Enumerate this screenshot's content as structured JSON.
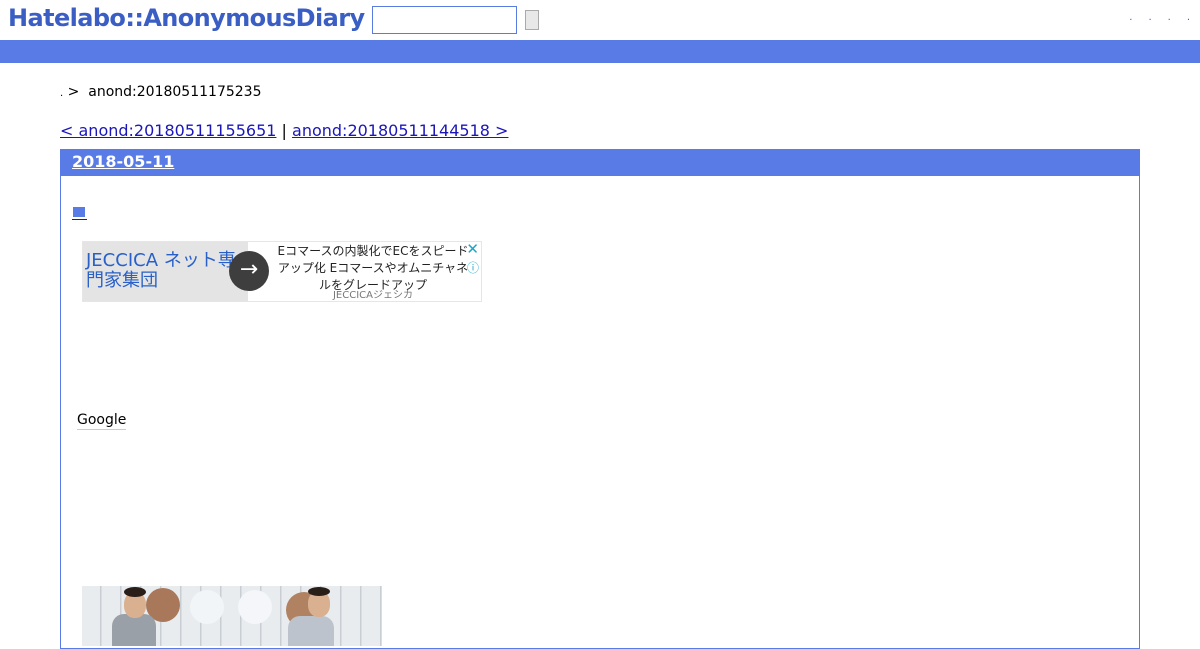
{
  "header": {
    "logo": "Hatelabo::AnonymousDiary",
    "search_value": "",
    "links": [
      ".",
      ".",
      ".",
      "."
    ]
  },
  "breadcrumb": {
    "home": ".",
    "separator": ">",
    "current": "anond:20180511175235"
  },
  "pager": {
    "prev": "< anond:20180511155651",
    "separator": "|",
    "next": "anond:20180511144518 >"
  },
  "day": {
    "date": "2018-05-11"
  },
  "ad": {
    "headline": "JECCICA ネット専門家集団",
    "arrow": "→",
    "body": "Eコマースの内製化でECをスピードアップ化 Eコマースやオムニチャネルをグレードアップ",
    "source": "JECCICAジェシカ",
    "close": "✕",
    "info": "ⓘ"
  },
  "google_label": "Google",
  "colors": {
    "brand": "#3a5ec4",
    "bar": "#587be5",
    "link": "#1a16b8",
    "ad_accent": "#1ea6c8"
  }
}
